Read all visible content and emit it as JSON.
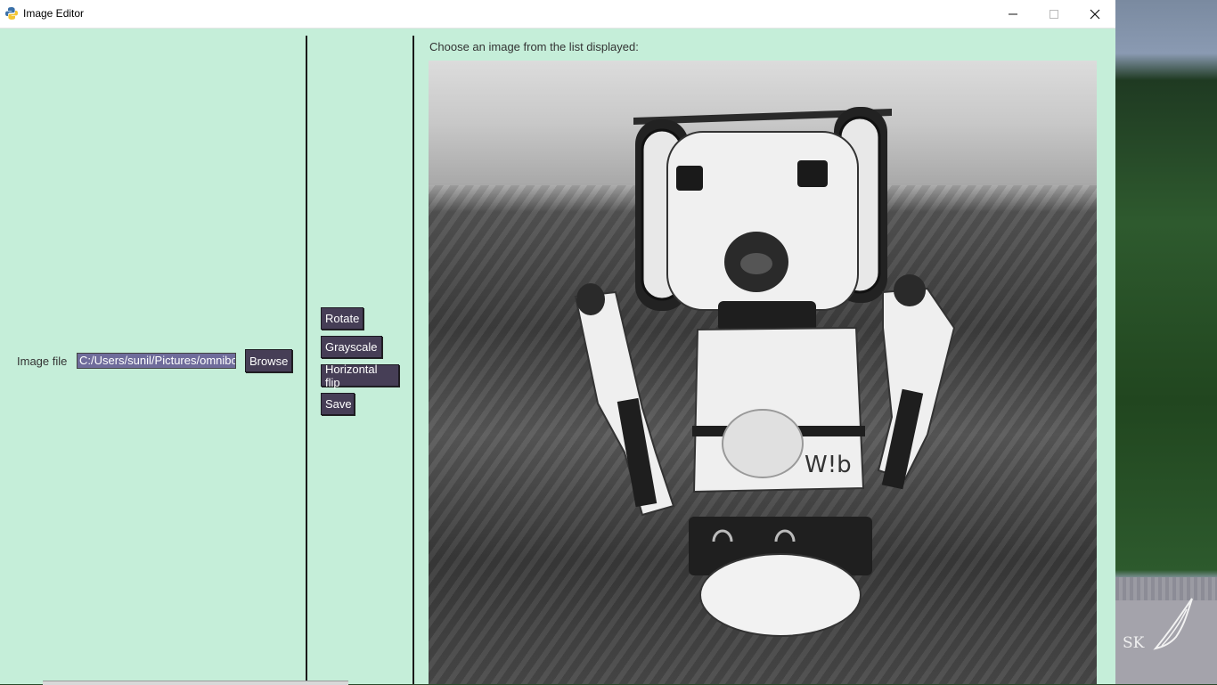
{
  "window": {
    "title": "Image Editor"
  },
  "left_panel": {
    "file_label": "Image file",
    "file_value": "C:/Users/sunil/Pictures/omnibot.jpg",
    "browse_label": "Browse"
  },
  "tools": {
    "rotate_label": "Rotate",
    "grayscale_label": "Grayscale",
    "hflip_label": "Horizontal flip",
    "save_label": "Save"
  },
  "viewer": {
    "prompt": "Choose an image from the list displayed:"
  },
  "wallpaper": {
    "watermark": "SK"
  },
  "colors": {
    "window_bg": "#c5eed9",
    "button_bg": "#463e56",
    "input_bg": "#6f6c9b"
  }
}
